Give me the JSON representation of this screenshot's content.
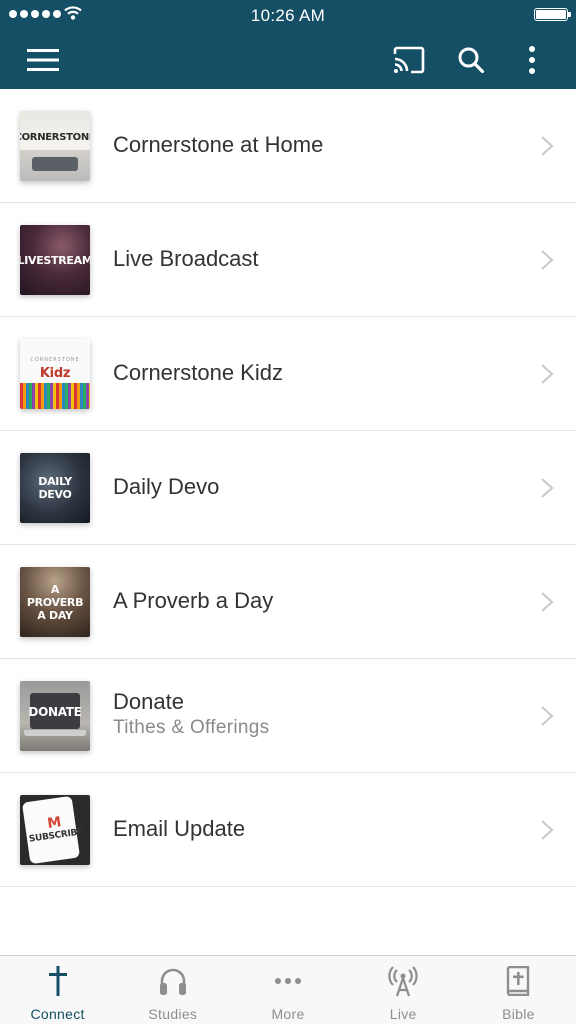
{
  "status_bar": {
    "time": "10:26 AM"
  },
  "toolbar": {
    "menu_icon": "hamburger-menu-icon",
    "cast_icon": "cast-icon",
    "search_icon": "search-icon",
    "more_icon": "vertical-ellipsis-icon"
  },
  "colors": {
    "header": "#154f66",
    "active_tab": "#154f66",
    "inactive_tab": "#8e8e8e"
  },
  "list": [
    {
      "title": "Cornerstone at Home",
      "subtitle": "",
      "thumb_text": "CORNERSTONE"
    },
    {
      "title": "Live Broadcast",
      "subtitle": "",
      "thumb_text": "LIVESTREAM"
    },
    {
      "title": "Cornerstone Kidz",
      "subtitle": "",
      "thumb_text": "Kidz",
      "thumb_small": "CORNERSTONE"
    },
    {
      "title": "Daily Devo",
      "subtitle": "",
      "thumb_text": "DAILY DEVO"
    },
    {
      "title": "A Proverb a Day",
      "subtitle": "",
      "thumb_text": "A PROVERB A DAY"
    },
    {
      "title": "Donate",
      "subtitle": "Tithes & Offerings",
      "thumb_text": "DONATE"
    },
    {
      "title": "Email Update",
      "subtitle": "",
      "thumb_text": "SUBSCRIBE",
      "thumb_mark": "M"
    }
  ],
  "tabs": [
    {
      "label": "Connect",
      "icon": "cross-icon",
      "active": true
    },
    {
      "label": "Studies",
      "icon": "headphones-icon",
      "active": false
    },
    {
      "label": "More",
      "icon": "horizontal-ellipsis-icon",
      "active": false
    },
    {
      "label": "Live",
      "icon": "broadcast-tower-icon",
      "active": false
    },
    {
      "label": "Bible",
      "icon": "bible-icon",
      "active": false
    }
  ]
}
